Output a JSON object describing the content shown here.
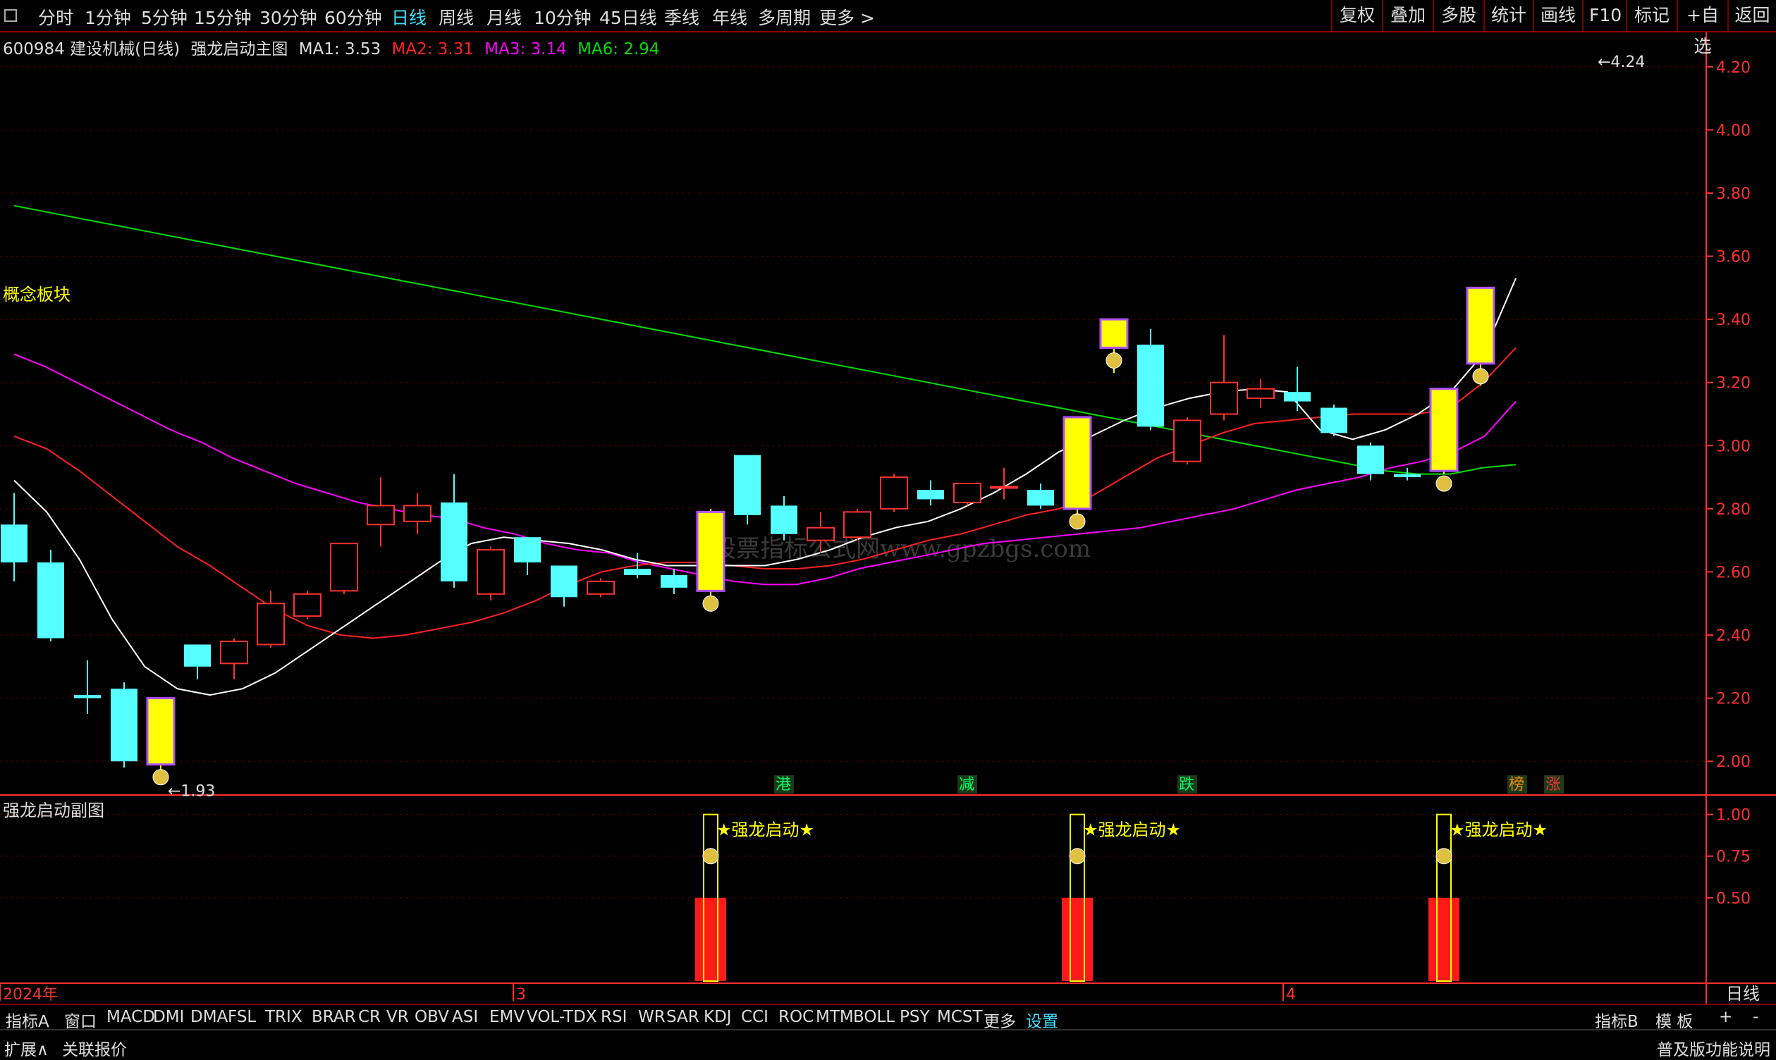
{
  "toolbar": {
    "periods": [
      "分时",
      "1分钟",
      "5分钟",
      "15分钟",
      "30分钟",
      "60分钟",
      "日线",
      "周线",
      "月线",
      "10分钟",
      "45日线",
      "季线",
      "年线",
      "多周期",
      "更多 >"
    ],
    "active_period": "日线",
    "right_buttons": [
      "复权",
      "叠加",
      "多股",
      "统计",
      "画线",
      "F10",
      "标记",
      "+自选",
      "返回"
    ]
  },
  "legend": {
    "stock": "600984 建设机械(日线)",
    "indicator": "强龙启动主图",
    "ma1": "MA1: 3.53",
    "ma2": "MA2: 3.31",
    "ma3": "MA3: 3.14",
    "ma6": "MA6: 2.94"
  },
  "colors": {
    "up": "#ff3030",
    "down": "#55ffff",
    "signal": "#ffff00",
    "ma1": "#ffffff",
    "ma2": "#ff2020",
    "ma3": "#ff00ff",
    "ma6": "#00dd00",
    "grid": "#7a0000",
    "axis": "#ff3030"
  },
  "concept_label": "概念板块",
  "sub_title": "强龙启动副图",
  "watermark": "股票指标公式网www.gpzbgs.com",
  "side_label": "日线",
  "chart_data": [
    {
      "type": "candlestick",
      "title": "强龙启动主图",
      "ylim": [
        1.9,
        4.3
      ],
      "yticks": [
        2.0,
        2.2,
        2.4,
        2.6,
        2.8,
        3.0,
        3.2,
        3.4,
        3.6,
        3.8,
        4.0,
        4.2
      ],
      "x_labels": [
        {
          "label": "2024年",
          "index": 0
        },
        {
          "label": "3",
          "index": 14
        },
        {
          "label": "4",
          "index": 35
        }
      ],
      "annotations": [
        {
          "text": "1.93",
          "index": 4,
          "value": 1.93
        },
        {
          "text": "4.24",
          "index": 43,
          "value": 4.24
        }
      ],
      "candles": [
        {
          "o": 2.75,
          "h": 2.85,
          "l": 2.57,
          "c": 2.63,
          "k": "down"
        },
        {
          "o": 2.63,
          "h": 2.67,
          "l": 2.38,
          "c": 2.39,
          "k": "down"
        },
        {
          "o": 2.21,
          "h": 2.32,
          "l": 2.15,
          "c": 2.2,
          "k": "down"
        },
        {
          "o": 2.23,
          "h": 2.25,
          "l": 1.98,
          "c": 2.0,
          "k": "down"
        },
        {
          "o": 1.99,
          "h": 2.2,
          "l": 1.97,
          "c": 2.2,
          "k": "signal"
        },
        {
          "o": 2.37,
          "h": 2.37,
          "l": 2.26,
          "c": 2.3,
          "k": "down"
        },
        {
          "o": 2.31,
          "h": 2.39,
          "l": 2.26,
          "c": 2.38,
          "k": "up"
        },
        {
          "o": 2.37,
          "h": 2.54,
          "l": 2.36,
          "c": 2.5,
          "k": "up"
        },
        {
          "o": 2.46,
          "h": 2.54,
          "l": 2.45,
          "c": 2.53,
          "k": "up"
        },
        {
          "o": 2.54,
          "h": 2.69,
          "l": 2.53,
          "c": 2.69,
          "k": "up"
        },
        {
          "o": 2.75,
          "h": 2.9,
          "l": 2.68,
          "c": 2.81,
          "k": "up"
        },
        {
          "o": 2.76,
          "h": 2.85,
          "l": 2.72,
          "c": 2.81,
          "k": "up"
        },
        {
          "o": 2.82,
          "h": 2.91,
          "l": 2.55,
          "c": 2.57,
          "k": "down"
        },
        {
          "o": 2.53,
          "h": 2.68,
          "l": 2.51,
          "c": 2.67,
          "k": "up"
        },
        {
          "o": 2.71,
          "h": 2.71,
          "l": 2.59,
          "c": 2.63,
          "k": "down"
        },
        {
          "o": 2.62,
          "h": 2.62,
          "l": 2.49,
          "c": 2.52,
          "k": "down"
        },
        {
          "o": 2.53,
          "h": 2.58,
          "l": 2.52,
          "c": 2.57,
          "k": "up"
        },
        {
          "o": 2.61,
          "h": 2.66,
          "l": 2.58,
          "c": 2.59,
          "k": "down"
        },
        {
          "o": 2.59,
          "h": 2.61,
          "l": 2.53,
          "c": 2.55,
          "k": "down"
        },
        {
          "o": 2.54,
          "h": 2.8,
          "l": 2.52,
          "c": 2.79,
          "k": "signal"
        },
        {
          "o": 2.97,
          "h": 2.97,
          "l": 2.75,
          "c": 2.78,
          "k": "down"
        },
        {
          "o": 2.81,
          "h": 2.84,
          "l": 2.7,
          "c": 2.72,
          "k": "down"
        },
        {
          "o": 2.7,
          "h": 2.79,
          "l": 2.66,
          "c": 2.74,
          "k": "up"
        },
        {
          "o": 2.71,
          "h": 2.8,
          "l": 2.7,
          "c": 2.79,
          "k": "up"
        },
        {
          "o": 2.8,
          "h": 2.91,
          "l": 2.79,
          "c": 2.9,
          "k": "up"
        },
        {
          "o": 2.86,
          "h": 2.89,
          "l": 2.81,
          "c": 2.83,
          "k": "down"
        },
        {
          "o": 2.82,
          "h": 2.88,
          "l": 2.81,
          "c": 2.88,
          "k": "up"
        },
        {
          "o": 2.87,
          "h": 2.93,
          "l": 2.83,
          "c": 2.87,
          "k": "up"
        },
        {
          "o": 2.86,
          "h": 2.88,
          "l": 2.8,
          "c": 2.81,
          "k": "down"
        },
        {
          "o": 2.8,
          "h": 3.09,
          "l": 2.78,
          "c": 3.09,
          "k": "signal"
        },
        {
          "o": 3.31,
          "h": 3.4,
          "l": 3.23,
          "c": 3.4,
          "k": "signal"
        },
        {
          "o": 3.32,
          "h": 3.37,
          "l": 3.05,
          "c": 3.06,
          "k": "down"
        },
        {
          "o": 3.08,
          "h": 3.09,
          "l": 2.94,
          "c": 2.95,
          "k": "up"
        },
        {
          "o": 3.1,
          "h": 3.35,
          "l": 3.08,
          "c": 3.2,
          "k": "up"
        },
        {
          "o": 3.15,
          "h": 3.21,
          "l": 3.12,
          "c": 3.18,
          "k": "up"
        },
        {
          "o": 3.17,
          "h": 3.25,
          "l": 3.11,
          "c": 3.14,
          "k": "down"
        },
        {
          "o": 3.12,
          "h": 3.13,
          "l": 3.03,
          "c": 3.04,
          "k": "down"
        },
        {
          "o": 3.0,
          "h": 3.01,
          "l": 2.89,
          "c": 2.91,
          "k": "down"
        },
        {
          "o": 2.91,
          "h": 2.93,
          "l": 2.89,
          "c": 2.9,
          "k": "down"
        },
        {
          "o": 2.92,
          "h": 3.18,
          "l": 2.91,
          "c": 3.18,
          "k": "signal"
        },
        {
          "o": 3.26,
          "h": 3.5,
          "l": 3.19,
          "c": 3.5,
          "k": "signal"
        }
      ],
      "ma1": [
        2.89,
        2.79,
        2.64,
        2.45,
        2.3,
        2.23,
        2.21,
        2.23,
        2.28,
        2.35,
        2.42,
        2.49,
        2.56,
        2.63,
        2.69,
        2.71,
        2.7,
        2.69,
        2.67,
        2.64,
        2.62,
        2.62,
        2.62,
        2.62,
        2.64,
        2.67,
        2.71,
        2.74,
        2.76,
        2.8,
        2.85,
        2.91,
        2.98,
        3.03,
        3.08,
        3.12,
        3.15,
        3.17,
        3.18,
        3.17,
        3.05,
        3.02,
        3.05,
        3.1,
        3.17,
        3.29,
        3.53
      ],
      "ma2": [
        3.03,
        2.99,
        2.92,
        2.84,
        2.76,
        2.68,
        2.62,
        2.55,
        2.48,
        2.43,
        2.4,
        2.39,
        2.4,
        2.42,
        2.44,
        2.47,
        2.51,
        2.56,
        2.6,
        2.62,
        2.63,
        2.63,
        2.62,
        2.61,
        2.61,
        2.62,
        2.64,
        2.67,
        2.7,
        2.72,
        2.75,
        2.78,
        2.8,
        2.84,
        2.9,
        2.96,
        3.0,
        3.04,
        3.07,
        3.08,
        3.09,
        3.1,
        3.1,
        3.1,
        3.12,
        3.2,
        3.31
      ],
      "ma3": [
        3.29,
        3.25,
        3.2,
        3.15,
        3.1,
        3.05,
        3.01,
        2.96,
        2.92,
        2.88,
        2.85,
        2.82,
        2.8,
        2.78,
        2.77,
        2.74,
        2.72,
        2.69,
        2.67,
        2.66,
        2.63,
        2.61,
        2.59,
        2.57,
        2.56,
        2.56,
        2.58,
        2.61,
        2.63,
        2.65,
        2.67,
        2.69,
        2.7,
        2.71,
        2.72,
        2.73,
        2.74,
        2.76,
        2.78,
        2.8,
        2.83,
        2.86,
        2.88,
        2.9,
        2.93,
        2.95,
        2.98,
        3.03,
        3.14
      ],
      "ma6": [
        3.76,
        3.74,
        3.72,
        3.7,
        3.68,
        3.66,
        3.64,
        3.62,
        3.6,
        3.58,
        3.56,
        3.54,
        3.52,
        3.5,
        3.48,
        3.46,
        3.44,
        3.42,
        3.4,
        3.38,
        3.36,
        3.34,
        3.32,
        3.3,
        3.28,
        3.26,
        3.24,
        3.22,
        3.2,
        3.18,
        3.16,
        3.14,
        3.12,
        3.1,
        3.08,
        3.06,
        3.04,
        3.02,
        3.0,
        2.98,
        2.96,
        2.94,
        2.92,
        2.91,
        2.91,
        2.93,
        2.94
      ],
      "event_labels": [
        {
          "text": "港",
          "index": 21,
          "color": "#00ff66"
        },
        {
          "text": "减",
          "index": 26,
          "color": "#00ff66"
        },
        {
          "text": "跌",
          "index": 32,
          "color": "#00ff66"
        },
        {
          "text": "榜",
          "index": 41,
          "color": "#ff8c00"
        },
        {
          "text": "涨",
          "index": 42,
          "color": "#ff3030"
        }
      ]
    },
    {
      "type": "bar",
      "title": "强龙启动副图",
      "ylim": [
        0,
        1.1
      ],
      "yticks": [
        0.5,
        0.75,
        1.0
      ],
      "signals": [
        {
          "index": 19,
          "value": 1.0,
          "label": "★强龙启动★"
        },
        {
          "index": 29,
          "value": 1.0,
          "label": "★强龙启动★"
        },
        {
          "index": 39,
          "value": 1.0,
          "label": "★强龙启动★"
        }
      ],
      "red_bars": [
        {
          "index": 19,
          "value": 0.5
        },
        {
          "index": 29,
          "value": 0.5
        },
        {
          "index": 39,
          "value": 0.5
        }
      ]
    }
  ],
  "bottom_tabs": [
    "指标A",
    "窗口",
    "MACD",
    "DMI",
    "DMA",
    "FSL",
    "TRIX",
    "BRAR",
    "CR",
    "VR",
    "OBV",
    "ASI",
    "EMV",
    "VOL-TDX",
    "RSI",
    "WR",
    "SAR",
    "KDJ",
    "CCI",
    "ROC",
    "MTM",
    "BOLL",
    "PSY",
    "MCST",
    "更多",
    "设置"
  ],
  "bottom_right": [
    "指标B",
    "模 板",
    "+",
    "-"
  ],
  "status": {
    "expand": "扩展∧",
    "related": "关联报价",
    "right": "普及版功能说明"
  }
}
